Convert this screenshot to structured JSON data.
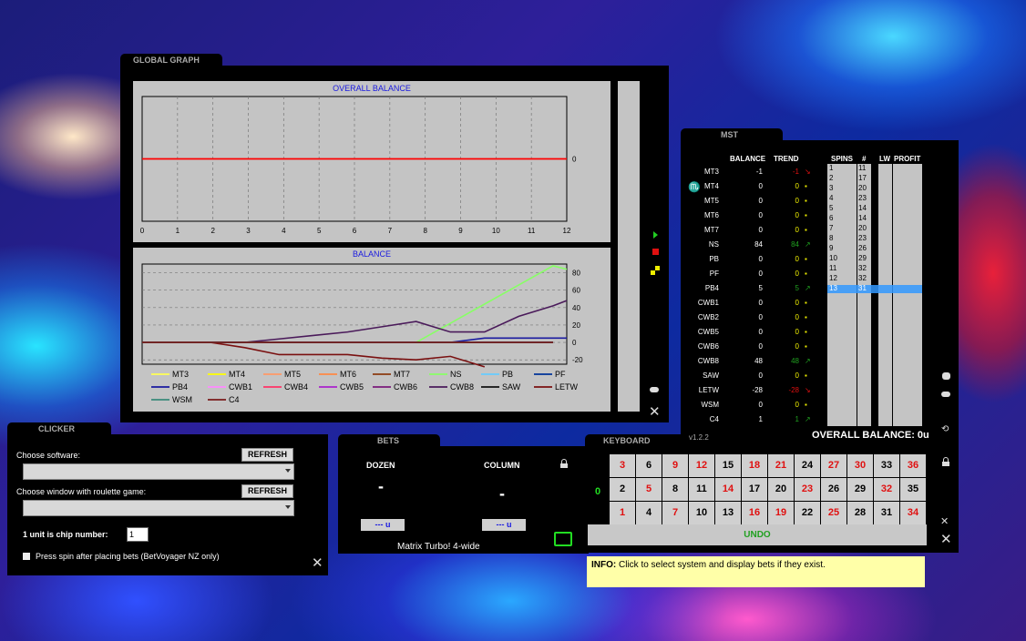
{
  "global_graph": {
    "tab": "GLOBAL GRAPH",
    "overall_chart": {
      "type": "line",
      "title": "OVERALL BALANCE",
      "x": [
        0,
        1,
        2,
        3,
        4,
        5,
        6,
        7,
        8,
        9,
        10,
        11,
        12
      ],
      "xticks": [
        "0",
        "1",
        "2",
        "3",
        "4",
        "5",
        "6",
        "7",
        "8",
        "9",
        "10",
        "11",
        "12"
      ],
      "yticks": [
        "0"
      ],
      "ylim": [
        -1,
        1
      ],
      "series": [
        {
          "values": [
            0,
            0,
            0,
            0,
            0,
            0,
            0,
            0,
            0,
            0,
            0,
            0,
            0
          ],
          "color": "#ff0000"
        }
      ]
    },
    "balance_chart": {
      "type": "line",
      "title": "BALANCE",
      "x": [
        0,
        1,
        2,
        3,
        4,
        5,
        6,
        7,
        8,
        9,
        10,
        11,
        12
      ],
      "yticks": [
        "80",
        "60",
        "40",
        "20",
        "0",
        "-20"
      ],
      "ylim": [
        -25,
        90
      ],
      "series": [
        {
          "name": "MT3",
          "color": "#ffff55",
          "values": [
            0,
            0,
            0,
            0,
            0,
            0,
            0,
            0,
            0,
            0,
            0,
            0,
            0
          ]
        },
        {
          "name": "MT4",
          "color": "#ffff00",
          "values": [
            0,
            0,
            0,
            0,
            0,
            0,
            0,
            0,
            0,
            0,
            0,
            0,
            0
          ]
        },
        {
          "name": "MT5",
          "color": "#ff9966",
          "values": [
            0,
            0,
            0,
            0,
            0,
            0,
            0,
            0,
            0,
            0,
            0,
            0,
            0
          ]
        },
        {
          "name": "MT6",
          "color": "#ff8844",
          "values": [
            0,
            0,
            0,
            0,
            0,
            0,
            0,
            0,
            0,
            0,
            0,
            0,
            0
          ]
        },
        {
          "name": "MT7",
          "color": "#8b3a10",
          "values": [
            0,
            0,
            0,
            0,
            0,
            0,
            0,
            0,
            0,
            0,
            0,
            0,
            0
          ]
        },
        {
          "name": "NS",
          "color": "#88ff66",
          "values": [
            0,
            0,
            0,
            0,
            0,
            0,
            0,
            0,
            0,
            22,
            44,
            66,
            88,
            84
          ]
        },
        {
          "name": "PB",
          "color": "#66ccff",
          "values": [
            0,
            0,
            0,
            0,
            0,
            0,
            0,
            0,
            0,
            0,
            0,
            0,
            0
          ]
        },
        {
          "name": "PF",
          "color": "#003399",
          "values": [
            0,
            0,
            0,
            0,
            0,
            0,
            0,
            0,
            0,
            0,
            0,
            0,
            0
          ]
        },
        {
          "name": "PB4",
          "color": "#1a1aa0",
          "values": [
            0,
            0,
            0,
            0,
            0,
            0,
            0,
            0,
            0,
            0,
            5,
            5,
            5,
            5
          ]
        },
        {
          "name": "CWB1",
          "color": "#ff88ff",
          "values": [
            0,
            0,
            0,
            0,
            0,
            0,
            0,
            0,
            0,
            0,
            0,
            0,
            0
          ]
        },
        {
          "name": "CWB4",
          "color": "#ff3366",
          "values": [
            0,
            0,
            0,
            0,
            0,
            0,
            0,
            0,
            0,
            0,
            0,
            0,
            0
          ]
        },
        {
          "name": "CWB5",
          "color": "#aa22cc",
          "values": [
            0,
            0,
            0,
            0,
            0,
            0,
            0,
            0,
            0,
            0,
            0,
            0,
            0
          ]
        },
        {
          "name": "CWB6",
          "color": "#7a1a7a",
          "values": [
            0,
            0,
            0,
            0,
            0,
            0,
            0,
            0,
            0,
            0,
            0,
            0,
            0
          ]
        },
        {
          "name": "CWB8",
          "color": "#4a1a5a",
          "values": [
            0,
            0,
            0,
            0,
            4,
            8,
            12,
            18,
            24,
            12,
            12,
            30,
            42,
            48
          ]
        },
        {
          "name": "SAW",
          "color": "#111111",
          "values": [
            0,
            0,
            0,
            0,
            0,
            0,
            0,
            0,
            0,
            0,
            0,
            0,
            0
          ]
        },
        {
          "name": "LETW",
          "color": "#7a1010",
          "values": [
            0,
            0,
            0,
            -6,
            -14,
            -14,
            -14,
            -18,
            -20,
            -16,
            -28
          ]
        },
        {
          "name": "WSM",
          "color": "#3a8a7a",
          "values": [
            0,
            0,
            0,
            0,
            0,
            0,
            0,
            0,
            0,
            0,
            0,
            0,
            0
          ]
        },
        {
          "name": "C4",
          "color": "#7a1a1a",
          "values": [
            0,
            0,
            0,
            0,
            0,
            0,
            0,
            0,
            0,
            0,
            0,
            0,
            0
          ]
        }
      ]
    }
  },
  "mst": {
    "tab": "MST",
    "headers": {
      "balance": "BALANCE",
      "trend": "TREND",
      "spins": "SPINS",
      "num": "#",
      "lw": "LW",
      "profit": "PROFIT"
    },
    "rows": [
      {
        "name": "MT3",
        "balance": "-1",
        "trend": "-1",
        "dir": "down"
      },
      {
        "name": "MT4",
        "balance": "0",
        "trend": "0",
        "dir": "flat"
      },
      {
        "name": "MT5",
        "balance": "0",
        "trend": "0",
        "dir": "flat"
      },
      {
        "name": "MT6",
        "balance": "0",
        "trend": "0",
        "dir": "flat"
      },
      {
        "name": "MT7",
        "balance": "0",
        "trend": "0",
        "dir": "flat"
      },
      {
        "name": "NS",
        "balance": "84",
        "trend": "84",
        "dir": "up"
      },
      {
        "name": "PB",
        "balance": "0",
        "trend": "0",
        "dir": "flat"
      },
      {
        "name": "PF",
        "balance": "0",
        "trend": "0",
        "dir": "flat"
      },
      {
        "name": "PB4",
        "balance": "5",
        "trend": "5",
        "dir": "up"
      },
      {
        "name": "CWB1",
        "balance": "0",
        "trend": "0",
        "dir": "flat"
      },
      {
        "name": "CWB2",
        "balance": "0",
        "trend": "0",
        "dir": "flat"
      },
      {
        "name": "CWB5",
        "balance": "0",
        "trend": "0",
        "dir": "flat"
      },
      {
        "name": "CWB6",
        "balance": "0",
        "trend": "0",
        "dir": "flat"
      },
      {
        "name": "CWB8",
        "balance": "48",
        "trend": "48",
        "dir": "up"
      },
      {
        "name": "SAW",
        "balance": "0",
        "trend": "0",
        "dir": "flat"
      },
      {
        "name": "LETW",
        "balance": "-28",
        "trend": "-28",
        "dir": "down"
      },
      {
        "name": "WSM",
        "balance": "0",
        "trend": "0",
        "dir": "flat"
      },
      {
        "name": "C4",
        "balance": "1",
        "trend": "1",
        "dir": "up"
      }
    ],
    "spins": [
      {
        "n": "1",
        "v": "11"
      },
      {
        "n": "2",
        "v": "17"
      },
      {
        "n": "3",
        "v": "20"
      },
      {
        "n": "4",
        "v": "23"
      },
      {
        "n": "5",
        "v": "14"
      },
      {
        "n": "6",
        "v": "14"
      },
      {
        "n": "7",
        "v": "20"
      },
      {
        "n": "8",
        "v": "23"
      },
      {
        "n": "9",
        "v": "26"
      },
      {
        "n": "10",
        "v": "29"
      },
      {
        "n": "11",
        "v": "32"
      },
      {
        "n": "12",
        "v": "32"
      },
      {
        "n": "13",
        "v": "31"
      }
    ],
    "overall_balance": "OVERALL BALANCE: 0u",
    "version": "v1.2.2"
  },
  "clicker": {
    "tab": "CLICKER",
    "choose_software": "Choose software:",
    "choose_window": "Choose window with roulette game:",
    "refresh": "REFRESH",
    "unit_label": "1 unit is chip number:",
    "unit_value": "1",
    "press_spin": "Press spin after placing bets (BetVoyager NZ only)"
  },
  "bets": {
    "tab": "BETS",
    "dozen": "DOZEN",
    "column": "COLUMN",
    "dozen_value": "-",
    "column_value": "-",
    "dozen_units": "--- u",
    "column_units": "--- u",
    "system": "Matrix Turbo! 4-wide"
  },
  "keyboard": {
    "tab": "KEYBOARD",
    "zero": "0",
    "undo": "UNDO",
    "rows": [
      [
        {
          "v": "3",
          "c": "r"
        },
        {
          "v": "6",
          "c": "b"
        },
        {
          "v": "9",
          "c": "r"
        },
        {
          "v": "12",
          "c": "r"
        },
        {
          "v": "15",
          "c": "b"
        },
        {
          "v": "18",
          "c": "r"
        },
        {
          "v": "21",
          "c": "r"
        },
        {
          "v": "24",
          "c": "b"
        },
        {
          "v": "27",
          "c": "r"
        },
        {
          "v": "30",
          "c": "r"
        },
        {
          "v": "33",
          "c": "b"
        },
        {
          "v": "36",
          "c": "r"
        }
      ],
      [
        {
          "v": "2",
          "c": "b"
        },
        {
          "v": "5",
          "c": "r"
        },
        {
          "v": "8",
          "c": "b"
        },
        {
          "v": "11",
          "c": "b"
        },
        {
          "v": "14",
          "c": "r"
        },
        {
          "v": "17",
          "c": "b"
        },
        {
          "v": "20",
          "c": "b"
        },
        {
          "v": "23",
          "c": "r"
        },
        {
          "v": "26",
          "c": "b"
        },
        {
          "v": "29",
          "c": "b"
        },
        {
          "v": "32",
          "c": "r"
        },
        {
          "v": "35",
          "c": "b"
        }
      ],
      [
        {
          "v": "1",
          "c": "r"
        },
        {
          "v": "4",
          "c": "b"
        },
        {
          "v": "7",
          "c": "r"
        },
        {
          "v": "10",
          "c": "b"
        },
        {
          "v": "13",
          "c": "b"
        },
        {
          "v": "16",
          "c": "r"
        },
        {
          "v": "19",
          "c": "r"
        },
        {
          "v": "22",
          "c": "b"
        },
        {
          "v": "25",
          "c": "r"
        },
        {
          "v": "28",
          "c": "b"
        },
        {
          "v": "31",
          "c": "b"
        },
        {
          "v": "34",
          "c": "r"
        }
      ]
    ]
  },
  "info": {
    "label": "INFO:",
    "text": "Click to select system and display bets if they exist."
  },
  "close": "✕",
  "colors": {
    "red": "#e01010",
    "green": "#20a020",
    "blue_label": "#1a1ae0"
  }
}
